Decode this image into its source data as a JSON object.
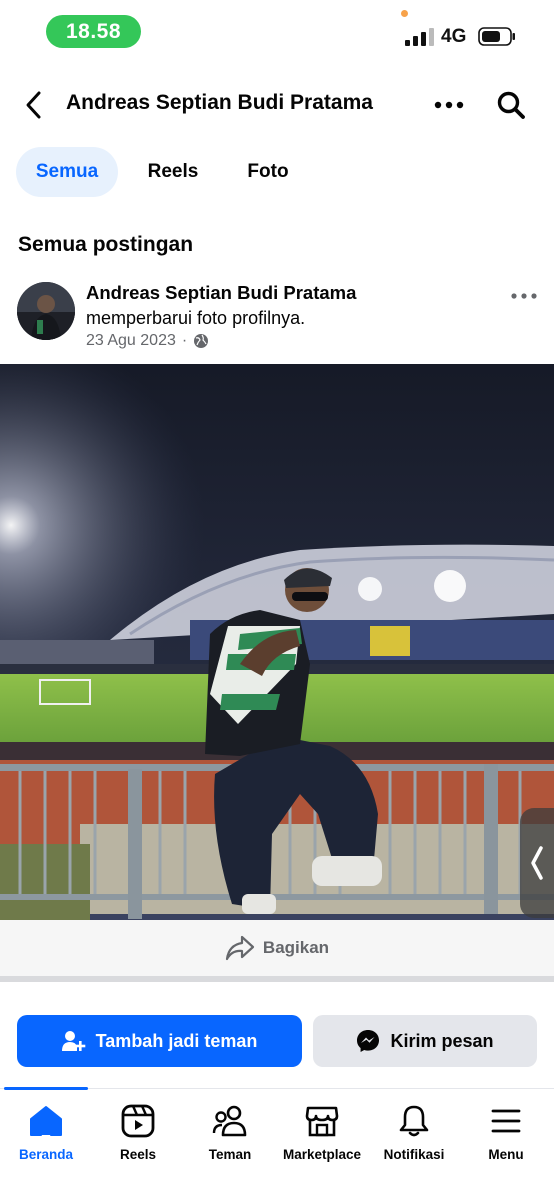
{
  "status_bar": {
    "time": "18.58",
    "network": "4G"
  },
  "header": {
    "title": "Andreas Septian Budi Pratama"
  },
  "tabs": [
    {
      "label": "Semua",
      "active": true
    },
    {
      "label": "Reels",
      "active": false
    },
    {
      "label": "Foto",
      "active": false
    }
  ],
  "section": {
    "title": "Semua postingan"
  },
  "post": {
    "author": "Andreas Septian Budi Pratama",
    "action": "memperbarui foto profilnya.",
    "date": "23 Agu 2023",
    "separator": "·",
    "privacy_icon": "globe-icon"
  },
  "share": {
    "label": "Bagikan"
  },
  "actions": {
    "add_friend_label": "Tambah jadi teman",
    "message_label": "Kirim pesan"
  },
  "bottom_nav": [
    {
      "label": "Beranda",
      "icon": "home-icon",
      "active": true
    },
    {
      "label": "Reels",
      "icon": "reels-icon",
      "active": false
    },
    {
      "label": "Teman",
      "icon": "friends-icon",
      "active": false
    },
    {
      "label": "Marketplace",
      "icon": "marketplace-icon",
      "active": false
    },
    {
      "label": "Notifikasi",
      "icon": "bell-icon",
      "active": false
    },
    {
      "label": "Menu",
      "icon": "menu-icon",
      "active": false
    }
  ],
  "colors": {
    "accent": "#0866ff",
    "status_green": "#34c759",
    "tab_active_bg": "#e7f1fd"
  }
}
